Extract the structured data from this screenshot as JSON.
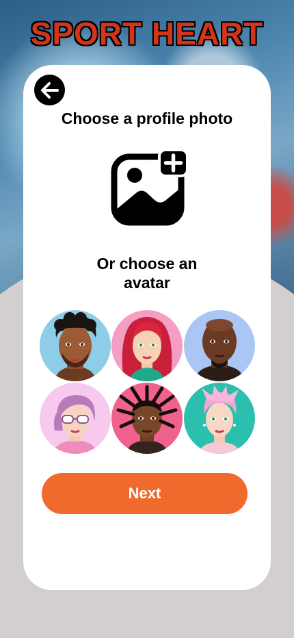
{
  "brand": {
    "title": "SPORT HEART"
  },
  "screen": {
    "title": "Choose a profile photo",
    "avatar_prompt_line1": "Or choose an",
    "avatar_prompt_line2": "avatar"
  },
  "icons": {
    "back": "arrow-left-icon",
    "upload": "add-photo-icon"
  },
  "avatars": [
    {
      "name": "avatar-curly-hair-man",
      "bg": "#8dcde8"
    },
    {
      "name": "avatar-red-hair-woman",
      "bg": "#f59ec4"
    },
    {
      "name": "avatar-bald-man",
      "bg": "#a9c6f5"
    },
    {
      "name": "avatar-purple-hair-glasses",
      "bg": "#f7c9ee"
    },
    {
      "name": "avatar-dreadlocks-man",
      "bg": "#f0628e"
    },
    {
      "name": "avatar-pink-hair-woman",
      "bg": "#2bbfae"
    }
  ],
  "actions": {
    "next_label": "Next"
  },
  "colors": {
    "accent": "#ef6a2c",
    "card": "#ffffff",
    "page_bg": "#d3cfcf"
  }
}
